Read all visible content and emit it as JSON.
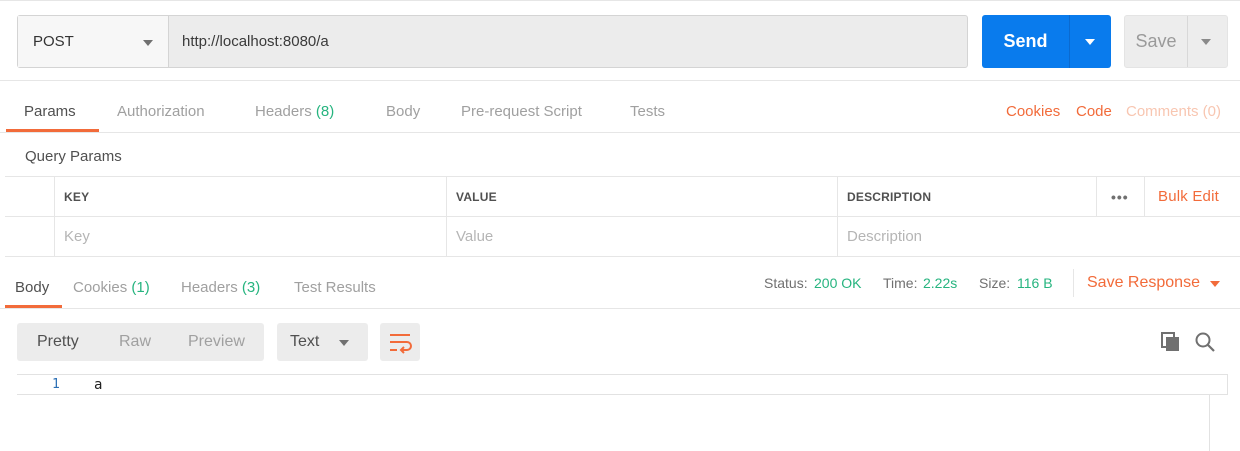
{
  "request": {
    "method": "POST",
    "url": "http://localhost:8080/a",
    "send_label": "Send",
    "save_label": "Save"
  },
  "request_tabs": {
    "params": "Params",
    "authorization": "Authorization",
    "headers": "Headers",
    "headers_count": "(8)",
    "body": "Body",
    "prerequest": "Pre-request Script",
    "tests": "Tests",
    "cookies": "Cookies",
    "code": "Code",
    "comments": "Comments (0)"
  },
  "query_params": {
    "title": "Query Params",
    "headers": {
      "key": "KEY",
      "value": "VALUE",
      "description": "DESCRIPTION"
    },
    "placeholders": {
      "key": "Key",
      "value": "Value",
      "description": "Description"
    },
    "more": "•••",
    "bulk_edit": "Bulk Edit"
  },
  "response_tabs": {
    "body": "Body",
    "cookies": "Cookies",
    "cookies_count": "(1)",
    "headers": "Headers",
    "headers_count": "(3)",
    "test_results": "Test Results"
  },
  "response_meta": {
    "status_label": "Status:",
    "status_value": "200 OK",
    "time_label": "Time:",
    "time_value": "2.22s",
    "size_label": "Size:",
    "size_value": "116 B",
    "save_response": "Save Response"
  },
  "viewer": {
    "pretty": "Pretty",
    "raw": "Raw",
    "preview": "Preview",
    "format": "Text"
  },
  "editor": {
    "line_number": "1",
    "line_text": "a"
  },
  "colors": {
    "accent": "#f26b3a",
    "send": "#097bed",
    "success": "#26b47f"
  }
}
